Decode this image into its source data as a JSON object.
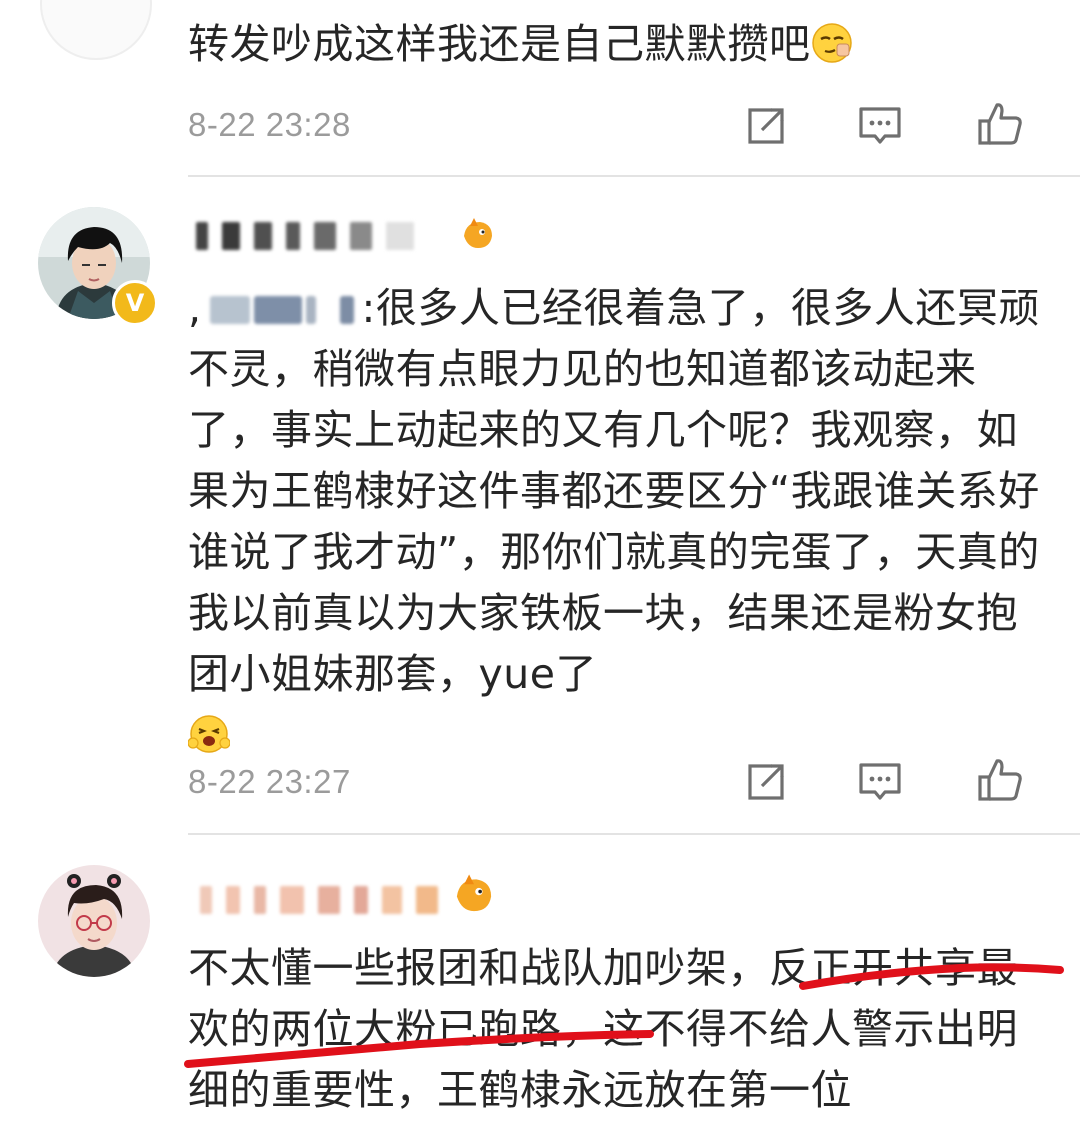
{
  "comments": [
    {
      "text": "转发吵成这样我还是自己默默攒吧",
      "time": "8-22 23:28"
    },
    {
      "mention_prefix": ",",
      "text": ":很多人已经很着急了，很多人还冥顽不灵，稍微有点眼力见的也知道都该动起来了，事实上动起来的又有几个呢？我观察，如果为王鹤棣好这件事都还要区分“我跟谁关系好谁说了我才动”，那你们就真的完蛋了，天真的我以前真以为大家铁板一块，结果还是粉女抱团小姐妹那套，yue了",
      "time": "8-22 23:27"
    },
    {
      "text": "不太懂一些报团和战队加吵架，反正开共享最欢的两位大粉已跑路，这不得不给人警示出明细的重要性，王鹤棣永远放在第一位"
    }
  ],
  "icons": {
    "repost": "repost-icon",
    "comment": "comment-icon",
    "like": "like-icon"
  },
  "colors": {
    "verified": "#f2b91a",
    "timestamp": "#9b9b9b",
    "annotation": "#e0101a"
  }
}
